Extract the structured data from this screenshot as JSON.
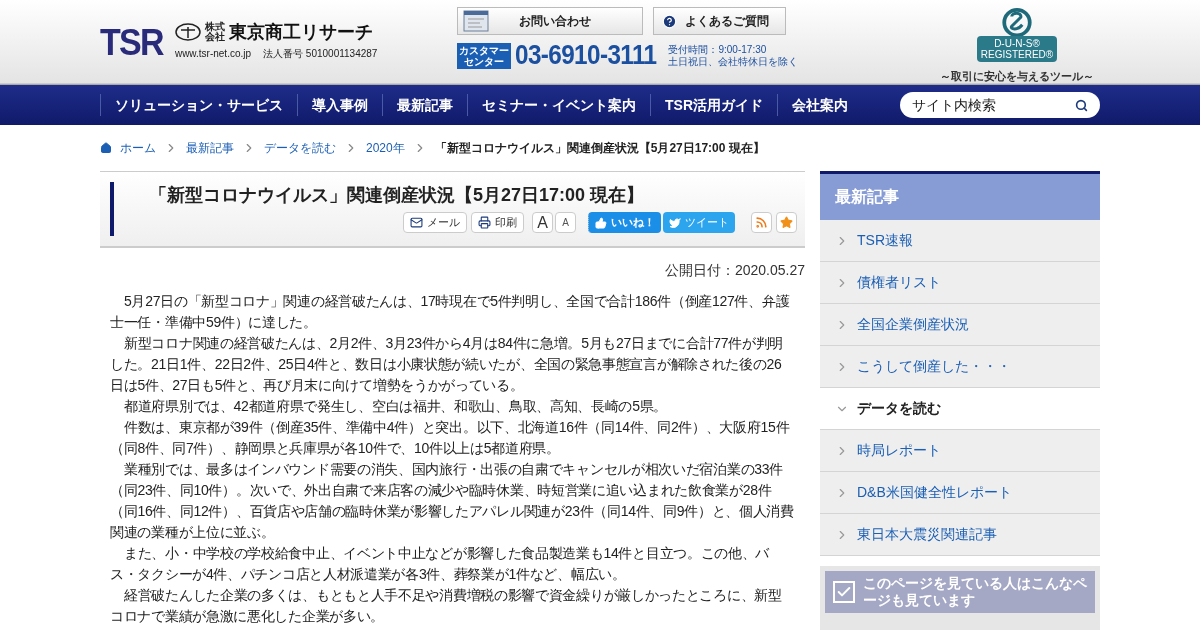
{
  "header": {
    "logo": "TSR",
    "company_prefix": "株式会社",
    "company": "東京商工リサーチ",
    "url": "www.tsr-net.co.jp",
    "corporate_number": "法人番号 5010001134287",
    "buttons": [
      {
        "kind": "contact",
        "label": "お問い合わせ"
      },
      {
        "kind": "faq",
        "label": "よくあるご質問"
      }
    ],
    "phone": {
      "badge": "カスタマーセンター",
      "number": "03-6910-3111",
      "hours": "受付時間：9:00-17:30",
      "closed": "土日祝日、会社特休日を除く"
    },
    "duns": {
      "line1": "D-U-N-S®",
      "line2": "REGISTERED®",
      "tagline": "～取引に安心を与えるツール～"
    }
  },
  "nav": {
    "items": [
      "ソリューション・サービス",
      "導入事例",
      "最新記事",
      "セミナー・イベント案内",
      "TSR活用ガイド",
      "会社案内"
    ],
    "search": {
      "placeholder": "サイト内検索"
    }
  },
  "breadcrumb": [
    "ホーム",
    "最新記事",
    "データを読む",
    "2020年",
    "「新型コロナウイルス」関連倒産状況【5月27日17:00 現在】"
  ],
  "article": {
    "title": "「新型コロナウイルス」関連倒産状況【5月27日17:00 現在】",
    "tools": [
      {
        "kind": "mail",
        "label": "メール"
      },
      {
        "kind": "print",
        "label": "印刷"
      },
      {
        "kind": "font_large",
        "label": "A"
      },
      {
        "kind": "font_small",
        "label": "A"
      },
      {
        "kind": "like",
        "label": "いいね！"
      },
      {
        "kind": "tweet",
        "label": "ツイート"
      },
      {
        "kind": "rss"
      },
      {
        "kind": "favorite"
      }
    ],
    "published": "公開日付：2020.05.27",
    "paragraphs": [
      "5月27日の「新型コロナ」関連の経営破たんは、17時現在で5件判明し、全国で合計186件（倒産127件、弁護士一任・準備中59件）に達した。",
      "新型コロナ関連の経営破たんは、2月2件、3月23件から4月は84件に急増。5月も27日までに合計77件が判明した。21日1件、22日2件、25日4件と、数日は小康状態が続いたが、全国の緊急事態宣言が解除された後の26日は5件、27日も5件と、再び月末に向けて増勢をうかがっている。",
      "都道府県別では、42都道府県で発生し、空白は福井、和歌山、鳥取、高知、長崎の5県。",
      "件数は、東京都が39件（倒産35件、準備中4件）と突出。以下、北海道16件（同14件、同2件）、大阪府15件（同8件、同7件）、静岡県と兵庫県が各10件で、10件以上は5都道府県。",
      "業種別では、最多はインバウンド需要の消失、国内旅行・出張の自粛でキャンセルが相次いだ宿泊業の33件（同23件、同10件）。次いで、外出自粛で来店客の減少や臨時休業、時短営業に追い込まれた飲食業が28件（同16件、同12件）、百貨店や店舗の臨時休業が影響したアパレル関連が23件（同14件、同9件）と、個人消費関連の業種が上位に並ぶ。",
      "また、小・中学校の学校給食中止、イベント中止などが影響した食品製造業も14件と目立つ。この他、バス・タクシーが4件、パチンコ店と人材派遣業が各3件、葬祭業が1件など、幅広い。",
      "経営破たんした企業の多くは、もともと人手不足や消費増税の影響で資金繰りが厳しかったところに、新型コロナで業績が急激に悪化した企業が多い。"
    ]
  },
  "sidebar": {
    "title": "最新記事",
    "items": [
      {
        "label": "TSR速報",
        "selected": false
      },
      {
        "label": "債権者リスト",
        "selected": false
      },
      {
        "label": "全国企業倒産状況",
        "selected": false
      },
      {
        "label": "こうして倒産した・・・",
        "selected": false
      },
      {
        "label": "データを読む",
        "selected": true
      },
      {
        "label": "時局レポート",
        "selected": false
      },
      {
        "label": "D&B米国健全性レポート",
        "selected": false
      },
      {
        "label": "東日本大震災関連記事",
        "selected": false
      }
    ],
    "related": {
      "title": "このページを見ている人はこんなページも見ています"
    }
  }
}
